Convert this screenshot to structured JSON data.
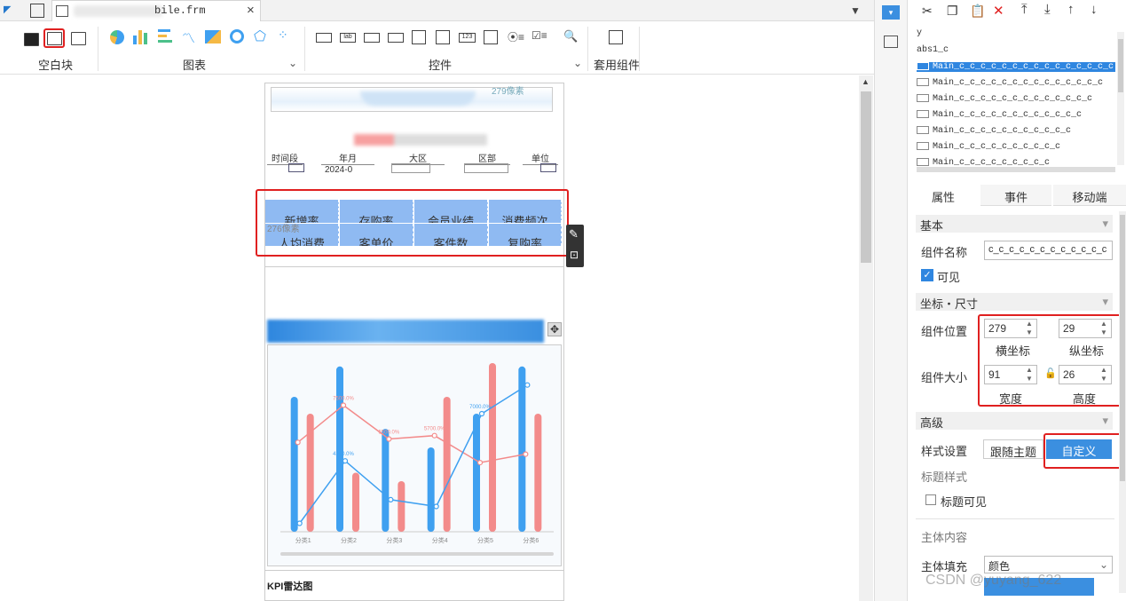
{
  "tab": {
    "filename": "bile.frm",
    "close": "×"
  },
  "toolbar": {
    "groups": [
      "空白块",
      "图表",
      "控件",
      "套用组件"
    ]
  },
  "canvas": {
    "header_label": "279像素",
    "mid_label": "276像素",
    "filters": [
      {
        "label": "时间段",
        "value": ""
      },
      {
        "label": "年月",
        "value": "2024-0"
      },
      {
        "label": "大区",
        "value": ""
      },
      {
        "label": "区部",
        "value": ""
      },
      {
        "label": "单位",
        "value": ""
      }
    ],
    "kpi_row1": [
      "新增率",
      "存购率",
      "会员业绩",
      "消费频次"
    ],
    "kpi_row2": [
      "人均消费",
      "客单价",
      "客件数",
      "复购率"
    ],
    "footer_label": "KPI雷达图"
  },
  "chart_data": {
    "type": "bar",
    "categories": [
      "分类1",
      "分类2",
      "分类3",
      "分类4",
      "分类5",
      "分类6"
    ],
    "ylim": [
      0,
      10000
    ],
    "series": [
      {
        "kind": "bar",
        "color": "#3fa0f0",
        "values": [
          8000,
          9800,
          6100,
          5000,
          7000,
          9800
        ]
      },
      {
        "kind": "bar",
        "color": "#f38b8b",
        "values": [
          7000,
          3500,
          3000,
          8000,
          12000,
          7000
        ]
      },
      {
        "kind": "line",
        "color": "#f38b8b",
        "values": [
          5300,
          7500,
          5500,
          5700,
          4100,
          4600
        ]
      },
      {
        "kind": "line",
        "color": "#3fa0f0",
        "values": [
          500,
          4200,
          1900,
          1500,
          7000,
          8700
        ]
      }
    ],
    "data_labels": [
      {
        "text": "7500.0%",
        "series": 2,
        "index": 1
      },
      {
        "text": "5500.0%",
        "series": 2,
        "index": 2
      },
      {
        "text": "5700.0%",
        "series": 2,
        "index": 3
      },
      {
        "text": "7000.0%",
        "series": 3,
        "index": 4
      },
      {
        "text": "4200.0%",
        "series": 3,
        "index": 1
      }
    ]
  },
  "right_panel": {
    "tree": {
      "items": [
        "y",
        "abs1_c",
        "Main_c_c_c_c_c_c_c_c_c_c_c_c_c_c_c",
        "Main_c_c_c_c_c_c_c_c_c_c_c_c_c_c",
        "Main_c_c_c_c_c_c_c_c_c_c_c_c_c",
        "Main_c_c_c_c_c_c_c_c_c_c_c_c",
        "Main_c_c_c_c_c_c_c_c_c_c_c",
        "Main_c_c_c_c_c_c_c_c_c_c",
        "Main_c_c_c_c_c_c_c_c_c"
      ]
    },
    "tabs": [
      "属性",
      "事件",
      "移动端"
    ],
    "sections": {
      "basic": "基本",
      "coords": "坐标・尺寸",
      "advanced": "高级",
      "title_style": "标题样式",
      "body_content": "主体内容"
    },
    "component_name_label": "组件名称",
    "component_name_value": "c_c_c_c_c_c_c_c_c_c_c_c",
    "visible_label": "可见",
    "position_label": "组件位置",
    "x": "279",
    "y": "29",
    "x_label": "横坐标",
    "y_label": "纵坐标",
    "size_label": "组件大小",
    "width": "91",
    "height": "26",
    "width_label": "宽度",
    "height_label": "高度",
    "style_label": "样式设置",
    "style_follow": "跟随主题",
    "style_custom": "自定义",
    "title_visible": "标题可见",
    "fill_label": "主体填充",
    "fill_value": "颜色"
  },
  "watermark": "CSDN @yuyang_622"
}
